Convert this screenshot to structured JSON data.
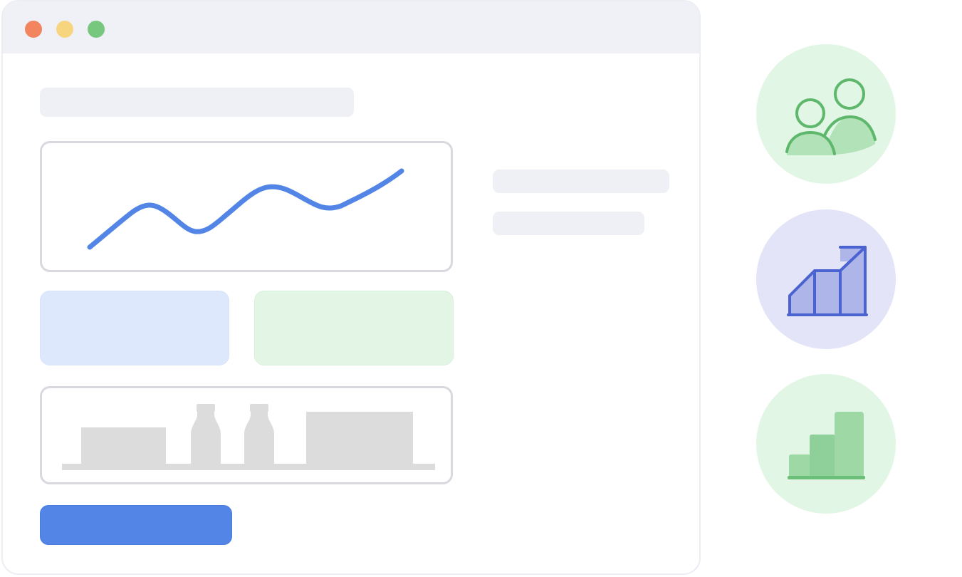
{
  "window_controls": [
    {
      "name": "close",
      "color": "#f2855f"
    },
    {
      "name": "minimize",
      "color": "#f7d47e"
    },
    {
      "name": "maximize",
      "color": "#78c77e"
    }
  ],
  "colors": {
    "accent_blue": "#5285e5",
    "line_blue": "#5285e5",
    "tile_blue": "#dde8fc",
    "tile_green": "#e3f6e6",
    "placeholder_gray": "#eff0f5",
    "card_border": "#d8d9df",
    "product_gray": "#dcdcdc",
    "users_circle_bg": "#e2f6e5",
    "users_icon_stroke": "#5eb86c",
    "users_icon_fill": "#b2e2b8",
    "growth_circle_bg": "#e3e4f7",
    "growth_icon_stroke": "#4a63d0",
    "growth_icon_fill": "#aeb6e9",
    "bars_circle_bg": "#e2f6e5",
    "bars_icon_fill": "#9ed8a5",
    "bars_icon_dark": "#8fd09a",
    "bars_icon_base": "#6cbf78"
  },
  "icons": {
    "users": "users-icon",
    "growth": "growth-chart-icon",
    "bars": "bar-chart-icon",
    "line_chart": "line-chart-icon",
    "products": "product-shelf-icon"
  }
}
